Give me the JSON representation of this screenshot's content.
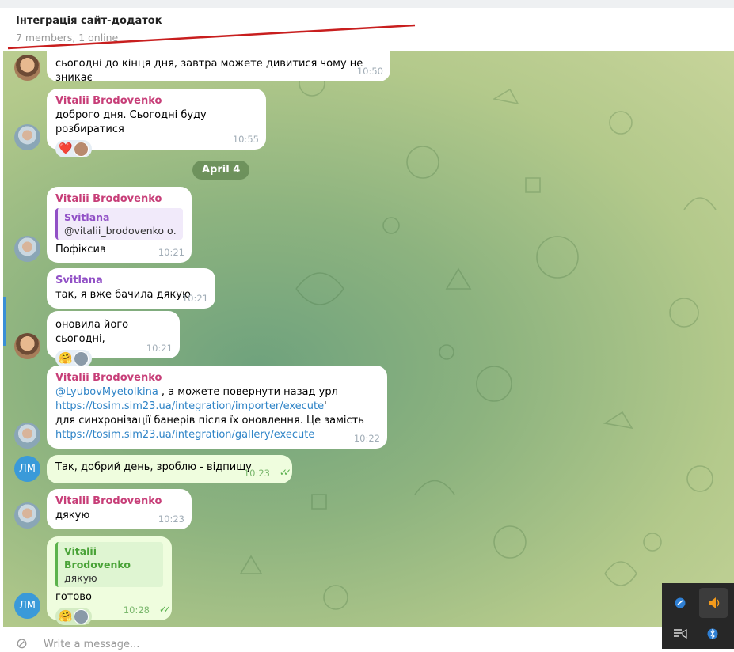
{
  "header": {
    "title": "Інтеграція сайт-додаток",
    "subtitle": "7 members, 1 online"
  },
  "messages": [
    {
      "text": "сьогодні до кінця дня, завтра можете дивитися чому не зникає",
      "time": "10:50"
    },
    {
      "sender": "Vitalii Brodovenko",
      "text": "доброго дня. Сьогодні буду розбиратися",
      "time": "10:55",
      "reaction": "❤️"
    },
    {
      "date": "April 4"
    },
    {
      "sender": "Vitalii Brodovenko",
      "reply_sender": "Svitlana",
      "reply_text": "@vitalii_brodovenko о...",
      "text": "Пофіксив",
      "time": "10:21"
    },
    {
      "sender": "Svitlana",
      "text": "так, я вже бачила дякую",
      "time": "10:21"
    },
    {
      "text": "оновила його сьогодні,",
      "time": "10:21",
      "reaction": "🤗"
    },
    {
      "sender": "Vitalii Brodovenko",
      "mention": "@LyubovMyetolkina",
      "line1_rest": " , а можете повернути назад урл",
      "link1": "https://tosim.sim23.ua/integration/importer/execute",
      "link1_suffix": "'",
      "line3": "для синхронізації банерів після їх оновлення. Це замість",
      "link2": "https://tosim.sim23.ua/integration/gallery/execute",
      "time": "10:22"
    },
    {
      "text": "Так, добрий день, зроблю - відпишу",
      "time": "10:23"
    },
    {
      "sender": "Vitalii Brodovenko",
      "text": "дякую",
      "time": "10:23"
    },
    {
      "reply_sender": "Vitalii Brodovenko",
      "reply_text": "дякую",
      "text": "готово",
      "time": "10:28",
      "reaction": "🤗"
    }
  ],
  "avatars": {
    "lm_initials": "ЛМ"
  },
  "input": {
    "placeholder": "Write a message..."
  },
  "colors": {
    "vitalii": "#c73e78",
    "svitlana": "#9150c6",
    "link": "#2f84c7",
    "outgoing_bubble": "#effdde"
  },
  "icons": [
    "attach-icon",
    "double-check-icon",
    "heart-icon",
    "hug-emoji-icon",
    "speaker-icon",
    "bluetooth-icon",
    "network-icon",
    "media-icon"
  ]
}
